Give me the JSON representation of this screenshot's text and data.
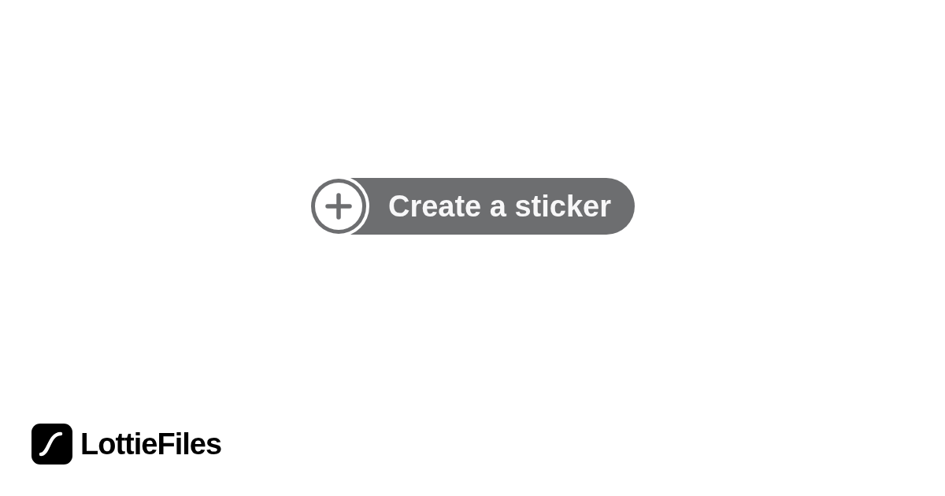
{
  "button": {
    "label": "Create a sticker"
  },
  "brand": {
    "name": "LottieFiles"
  }
}
